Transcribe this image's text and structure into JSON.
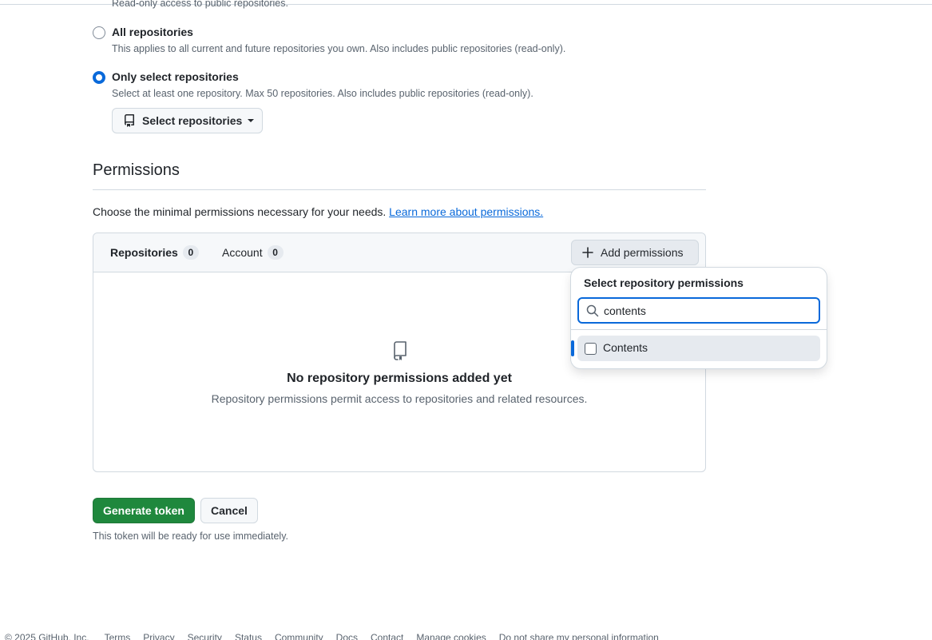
{
  "access": {
    "clipped_text": "Read-only access to public repositories.",
    "options": [
      {
        "label": "All repositories",
        "description": "This applies to all current and future repositories you own. Also includes public repositories (read-only).",
        "selected": false
      },
      {
        "label": "Only select repositories",
        "description": "Select at least one repository. Max 50 repositories. Also includes public repositories (read-only).",
        "selected": true
      }
    ],
    "select_button_label": "Select repositories"
  },
  "permissions": {
    "heading": "Permissions",
    "description": "Choose the minimal permissions necessary for your needs.",
    "learn_more_link": "Learn more about permissions.",
    "tabs": [
      {
        "label": "Repositories",
        "count": "0",
        "active": true
      },
      {
        "label": "Account",
        "count": "0",
        "active": false
      }
    ],
    "add_button_label": "Add permissions",
    "empty": {
      "icon": "repo-icon",
      "title": "No repository permissions added yet",
      "description": "Repository permissions permit access to repositories and related resources."
    }
  },
  "dropdown": {
    "title": "Select repository permissions",
    "search_value": "contents",
    "items": [
      {
        "label": "Contents",
        "checked": false
      }
    ]
  },
  "actions": {
    "generate_label": "Generate token",
    "cancel_label": "Cancel",
    "note": "This token will be ready for use immediately."
  },
  "footer": {
    "copyright": "© 2025 GitHub, Inc.",
    "links": [
      "Terms",
      "Privacy",
      "Security",
      "Status",
      "Community",
      "Docs",
      "Contact",
      "Manage cookies",
      "Do not share my personal information"
    ]
  },
  "colors": {
    "accent": "#0969da",
    "primary_button": "#1f883d",
    "border": "#d1d9e0",
    "muted_text": "#59636e"
  }
}
